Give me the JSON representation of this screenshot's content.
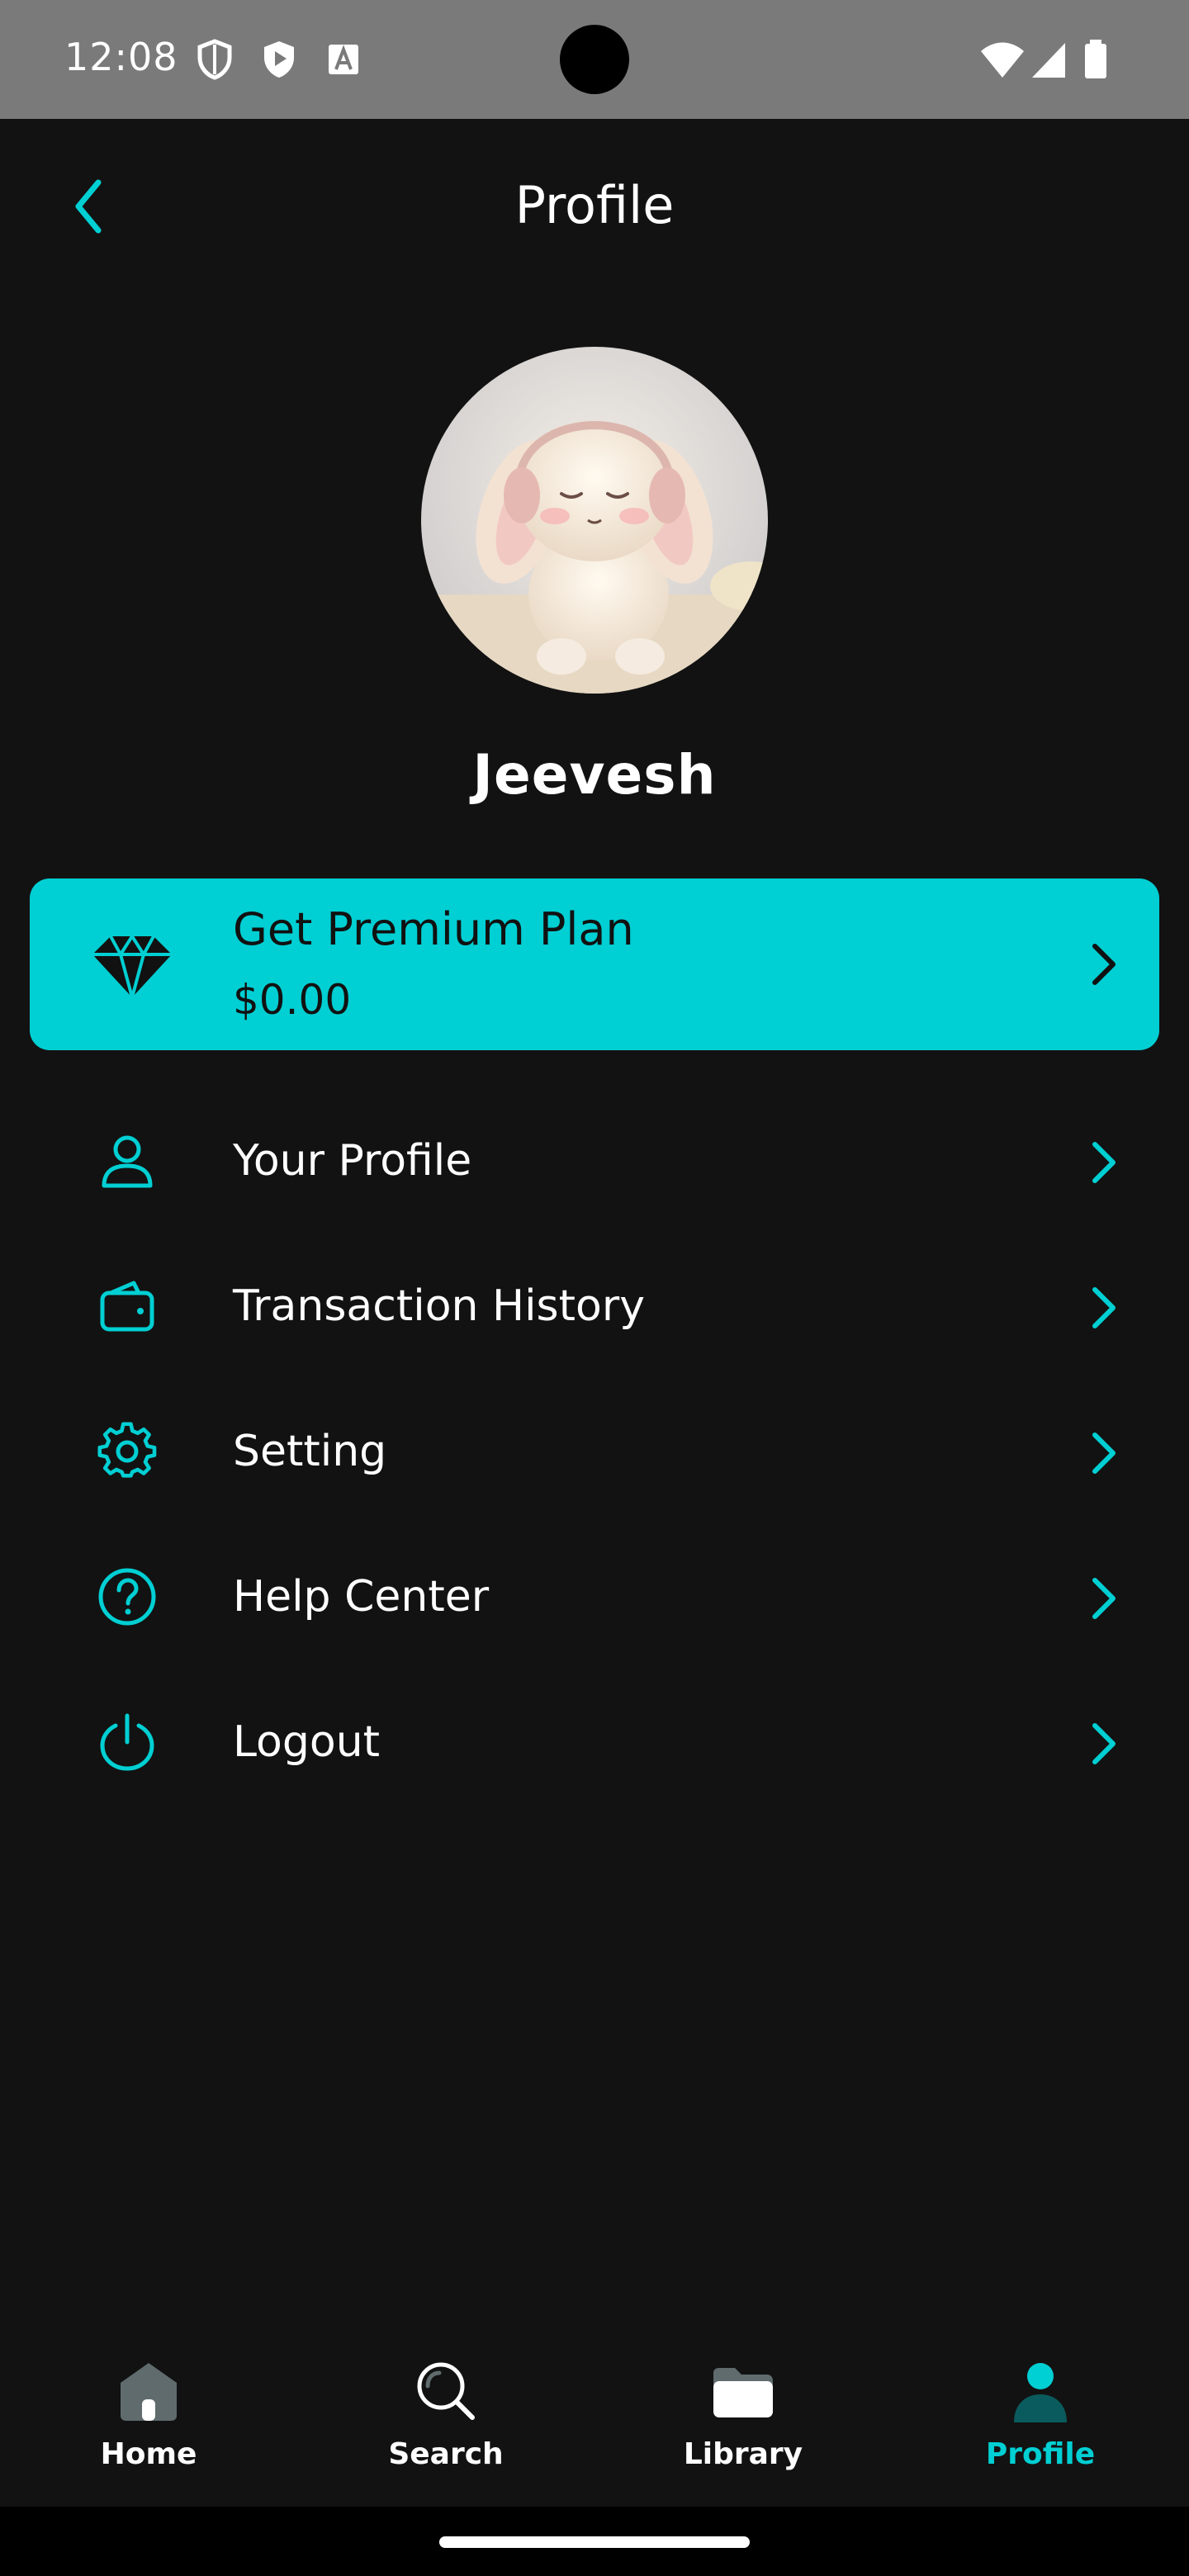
{
  "status_bar": {
    "time": "12:08",
    "icons": [
      "shield-outline-icon",
      "play-shield-icon",
      "font-a-icon",
      "wifi-icon",
      "signal-icon",
      "battery-icon"
    ]
  },
  "header": {
    "title": "Profile",
    "back_icon": "chevron-left-icon"
  },
  "profile": {
    "name": "Jeevesh",
    "avatar": "avatar-image"
  },
  "premium": {
    "title": "Get Premium Plan",
    "price": "$0.00",
    "icon": "diamond-icon"
  },
  "menu": {
    "items": [
      {
        "label": "Your Profile",
        "icon": "user-icon"
      },
      {
        "label": "Transaction History",
        "icon": "wallet-icon"
      },
      {
        "label": "Setting",
        "icon": "gear-icon"
      },
      {
        "label": "Help Center",
        "icon": "help-circle-icon"
      },
      {
        "label": "Logout",
        "icon": "power-icon"
      }
    ]
  },
  "bottom_nav": {
    "items": [
      {
        "label": "Home",
        "icon": "home-icon",
        "active": false
      },
      {
        "label": "Search",
        "icon": "search-icon",
        "active": false
      },
      {
        "label": "Library",
        "icon": "folder-icon",
        "active": false
      },
      {
        "label": "Profile",
        "icon": "person-icon",
        "active": true
      }
    ]
  },
  "colors": {
    "accent": "#00cfd3",
    "background": "#121212",
    "status_bar": "#7a7a7a",
    "text": "#ffffff"
  }
}
